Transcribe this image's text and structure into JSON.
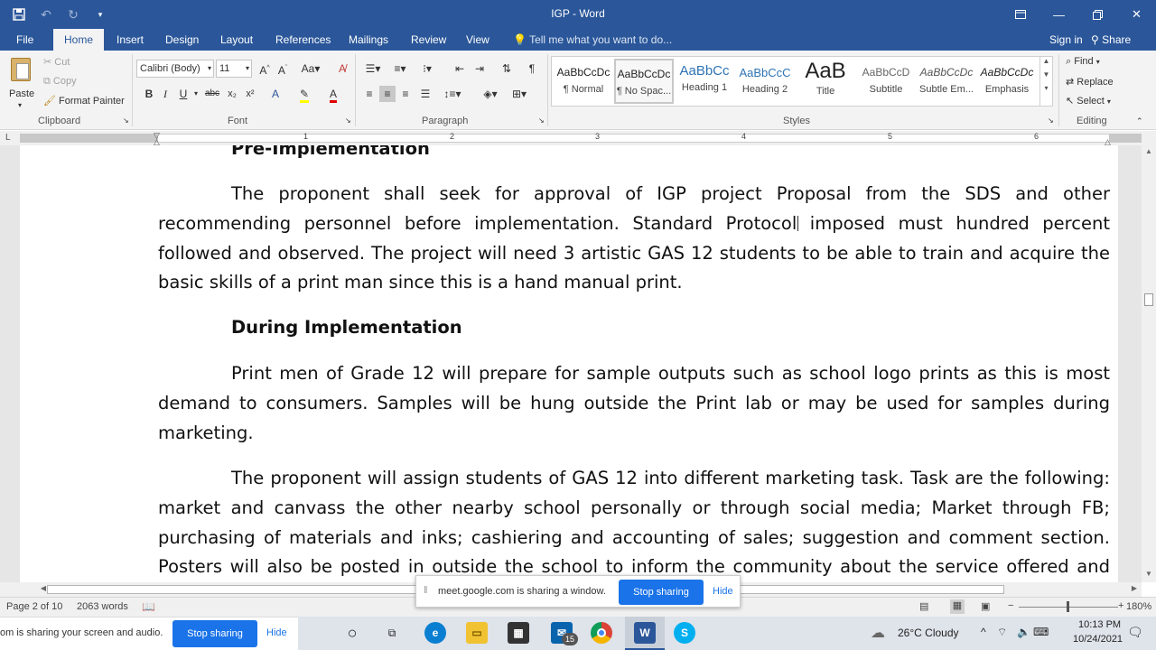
{
  "window": {
    "title": "IGP - Word",
    "qat": [
      "save-icon",
      "undo-icon",
      "redo-icon",
      "customize-icon"
    ],
    "controls": [
      "ribbon-display-icon",
      "minimize-icon",
      "restore-icon",
      "close-icon"
    ]
  },
  "tabs": [
    "File",
    "Home",
    "Insert",
    "Design",
    "Layout",
    "References",
    "Mailings",
    "Review",
    "View"
  ],
  "active_tab": "Home",
  "tell_me": "Tell me what you want to do...",
  "signin": "Sign in",
  "share": "Share",
  "ribbon": {
    "clipboard": {
      "label": "Clipboard",
      "paste": "Paste",
      "cut": "Cut",
      "copy": "Copy",
      "format_painter": "Format Painter"
    },
    "font": {
      "label": "Font",
      "font_name": "Calibri (Body)",
      "font_size": "11"
    },
    "paragraph": {
      "label": "Paragraph"
    },
    "styles": {
      "label": "Styles",
      "items": [
        {
          "preview": "AaBbCcDc",
          "name": "¶ Normal"
        },
        {
          "preview": "AaBbCcDc",
          "name": "¶ No Spac..."
        },
        {
          "preview": "AaBbCc",
          "name": "Heading 1"
        },
        {
          "preview": "AaBbCcC",
          "name": "Heading 2"
        },
        {
          "preview": "AaB",
          "name": "Title"
        },
        {
          "preview": "AaBbCcD",
          "name": "Subtitle"
        },
        {
          "preview": "AaBbCcDc",
          "name": "Subtle Em..."
        },
        {
          "preview": "AaBbCcDc",
          "name": "Emphasis"
        }
      ],
      "selected_index": 1
    },
    "editing": {
      "label": "Editing",
      "find": "Find",
      "replace": "Replace",
      "select": "Select"
    }
  },
  "ruler": {
    "numbers": [
      "1",
      "2",
      "3",
      "4",
      "5",
      "6"
    ]
  },
  "document": {
    "heading_pre": "Pre-Implementation",
    "p1_line1": "The proponent shall seek for approval of IGP project Proposal from the SDS and other",
    "p1_line2": "recommending personnel before implementation. Standard Protocol imposed must hundred percent",
    "p1_line3": "followed and observed. The project will need 3 artistic GAS 12 students to be able to train and acquire the",
    "p1_line4": "basic skills of a print man since this is a hand manual print.",
    "heading_during": "During Implementation",
    "p2_line1": "Print men of Grade 12 will prepare for sample outputs such as school logo prints as this is most",
    "p2_line2": "demand to consumers. Samples will be hung outside the Print lab or may be used for samples during",
    "p2_line3": "marketing.",
    "p3_line1": "The proponent will assign students of GAS 12 into different marketing task. Task are the following:",
    "p3_line2": "market and canvass the other nearby school personally or through social media; Market through FB;",
    "p3_line3": "purchasing of materials and inks; cashiering and accounting of sales; suggestion and comment section.",
    "p3_line4": "Posters will also be posted in outside the school to inform the community about the service offered and"
  },
  "status": {
    "page": "Page 2 of 10",
    "words": "2063 words",
    "zoom": "180%"
  },
  "meet": {
    "message": "meet.google.com is sharing a window.",
    "stop": "Stop sharing",
    "hide": "Hide"
  },
  "share_bar": {
    "message": "om is sharing your screen and audio.",
    "stop": "Stop sharing",
    "hide": "Hide"
  },
  "taskbar": {
    "mail_badge": "15",
    "weather": "26°C  Cloudy",
    "time": "10:13 PM",
    "date": "10/24/2021"
  }
}
